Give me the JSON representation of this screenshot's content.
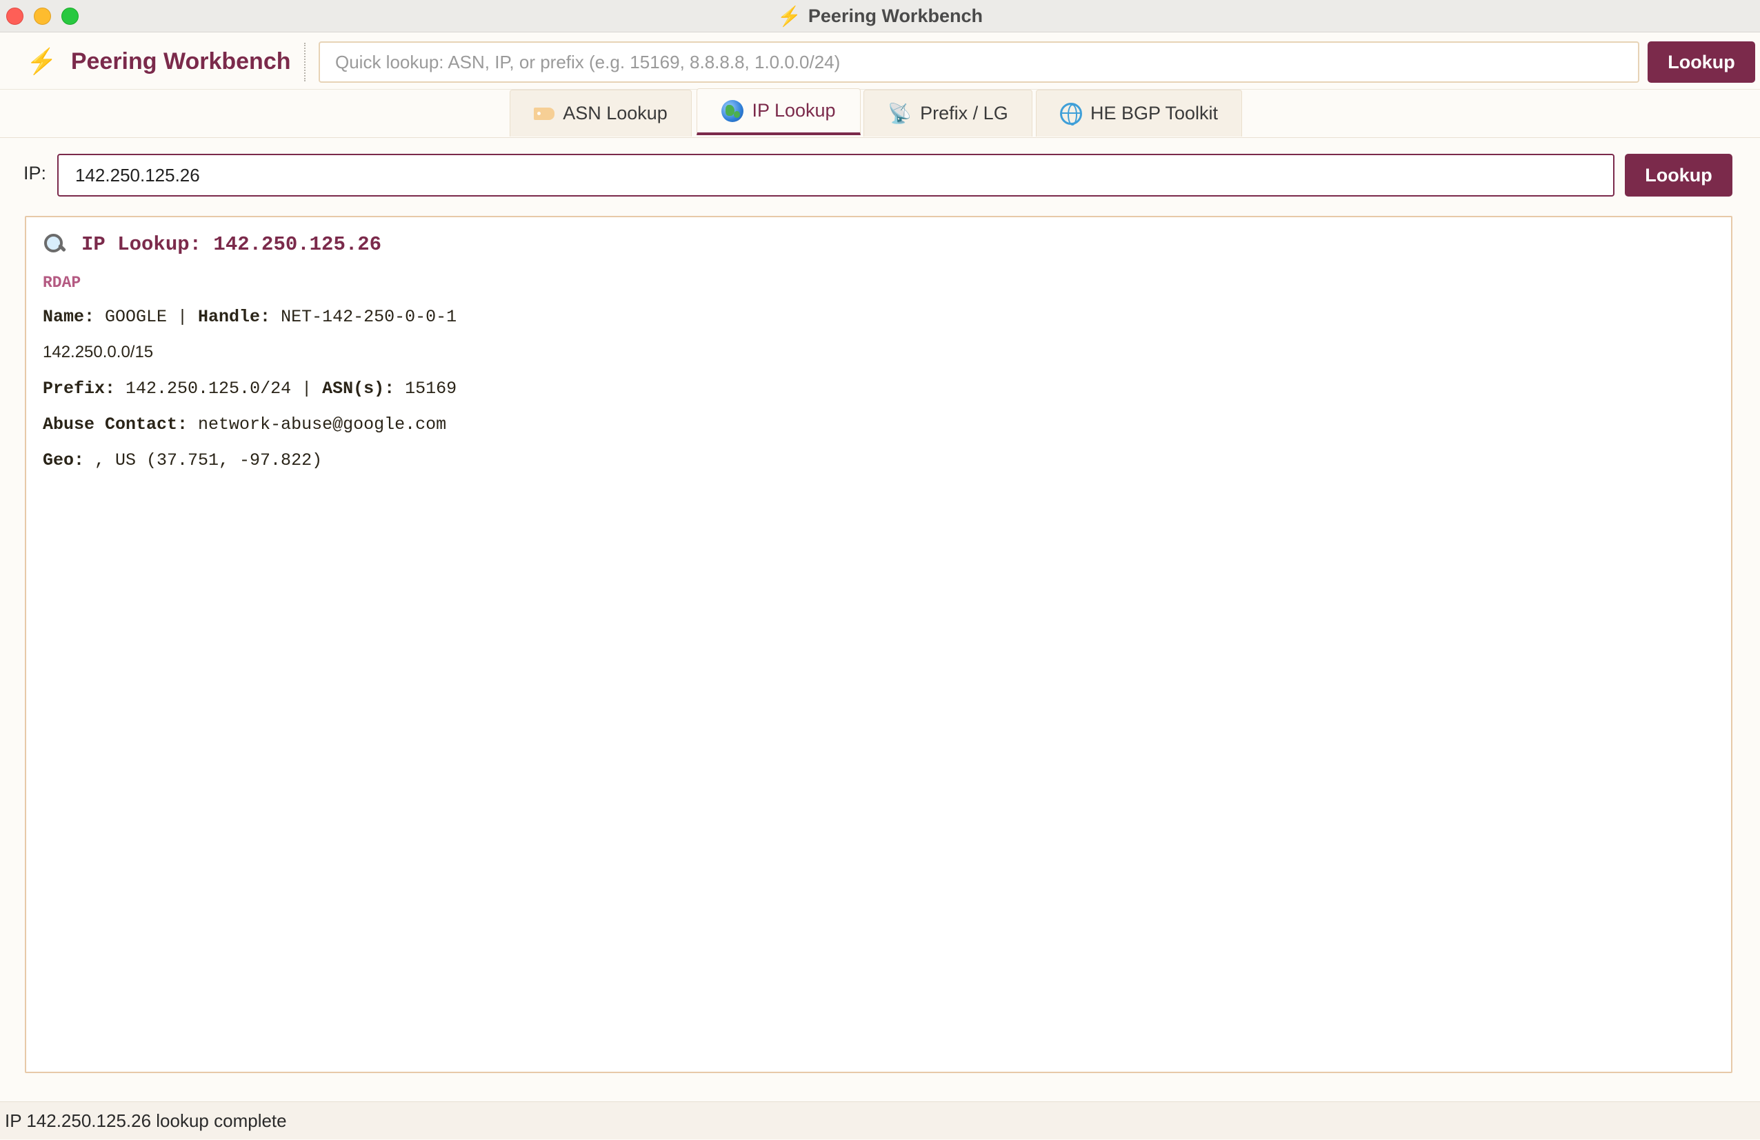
{
  "window": {
    "title": "Peering Workbench",
    "title_icon": "⚡"
  },
  "header": {
    "brand_icon": "⚡",
    "brand_name": "Peering Workbench",
    "quick_placeholder": "Quick lookup: ASN, IP, or prefix (e.g. 15169, 8.8.8.8, 1.0.0.0/24)",
    "quick_value": "",
    "lookup_label": "Lookup"
  },
  "tabs": [
    {
      "label": "ASN Lookup",
      "icon": "tag-icon",
      "active": false
    },
    {
      "label": "IP Lookup",
      "icon": "globe-icon",
      "active": true
    },
    {
      "label": "Prefix / LG",
      "icon": "satellite-dish-icon",
      "active": false
    },
    {
      "label": "HE BGP Toolkit",
      "icon": "web-globe-icon",
      "active": false
    }
  ],
  "ip_form": {
    "label": "IP:",
    "value": "142.250.125.26",
    "button_label": "Lookup"
  },
  "result": {
    "title": "IP Lookup: 142.250.125.26",
    "section": "RDAP",
    "name_label": "Name:",
    "name_value": " GOOGLE | ",
    "handle_label": "Handle:",
    "handle_value": " NET-142-250-0-0-1",
    "cidr": "142.250.0.0/15",
    "prefix_label": "Prefix:",
    "prefix_value": " 142.250.125.0/24 | ",
    "asn_label": "ASN(s):",
    "asn_value": " 15169",
    "abuse_label": "Abuse Contact:",
    "abuse_value": " network-abuse@google.com",
    "geo_label": "Geo:",
    "geo_value": " , US (37.751, -97.822)"
  },
  "status": {
    "text": "IP 142.250.125.26 lookup complete"
  },
  "colors": {
    "accent": "#7b2a4b",
    "bolt": "#f2b824",
    "section": "#b45a82"
  }
}
